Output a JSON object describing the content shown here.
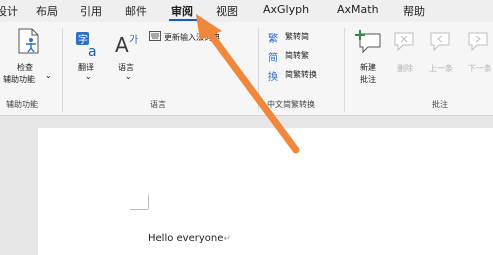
{
  "tabs": [
    {
      "label": "设计"
    },
    {
      "label": "布局"
    },
    {
      "label": "引用"
    },
    {
      "label": "邮件"
    },
    {
      "label": "审阅",
      "active": true
    },
    {
      "label": "视图"
    },
    {
      "label": "AxGlyph"
    },
    {
      "label": "AxMath"
    },
    {
      "label": "帮助"
    }
  ],
  "ribbon": {
    "proofing": {
      "check_label_1": "检查",
      "check_label_2": "辅助功能",
      "check_dropdown": "⌄",
      "group": "辅助功能"
    },
    "language": {
      "translate": "翻译",
      "language": "语言",
      "update_ime": "更新输入法词典",
      "group": "语言"
    },
    "chinese_conversion": {
      "to_traditional": "繁转简",
      "to_simplified": "简转繁",
      "conversion": "简繁转换",
      "group": "中文简繁转换"
    },
    "comments": {
      "new_1": "新建",
      "new_2": "批注",
      "delete": "删除",
      "previous": "上一条",
      "next": "下一条",
      "group": "批注"
    }
  },
  "document": {
    "text": "Hello everyone",
    "paragraph_mark": "↵"
  },
  "annotation": {
    "arrow_color": "#f0873a"
  }
}
